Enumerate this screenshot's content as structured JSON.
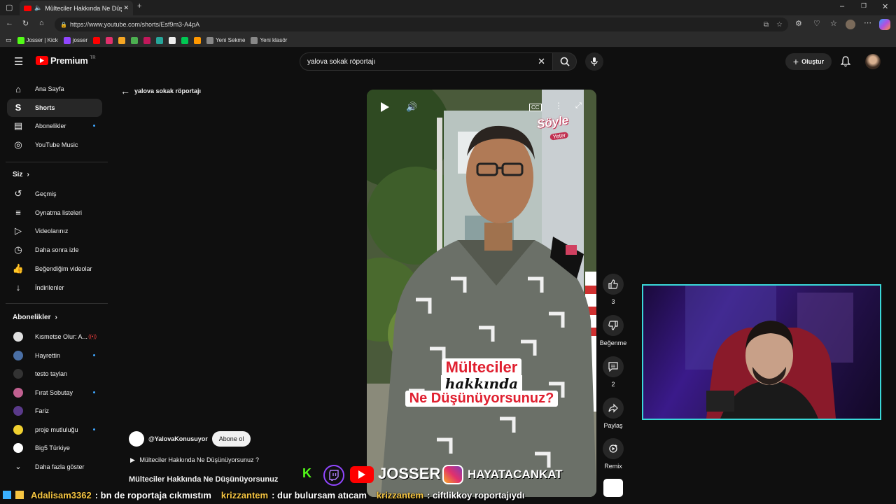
{
  "browser": {
    "tab_title": "Mülteciler Hakkında Ne Düşü",
    "url": "https://www.youtube.com/shorts/Esf9m3-A4pA",
    "bookmarks": [
      {
        "label": "Josser | Kick",
        "color": "#53fc18"
      },
      {
        "label": "josser",
        "color": "#9146ff"
      },
      {
        "label": "",
        "color": "#ff0000"
      },
      {
        "label": "",
        "color": "#e1306c"
      },
      {
        "label": "",
        "color": "#f5a623"
      },
      {
        "label": "",
        "color": "#4caf50"
      },
      {
        "label": "",
        "color": "#c2185b"
      },
      {
        "label": "",
        "color": "#26a69a"
      },
      {
        "label": "",
        "color": "#eeeeee"
      },
      {
        "label": "",
        "color": "#00c853"
      },
      {
        "label": "",
        "color": "#ff9800"
      },
      {
        "label": "Yeni Sekme",
        "color": "#888888"
      },
      {
        "label": "Yeni klasör",
        "color": "#888888"
      }
    ]
  },
  "header": {
    "logo_text": "Premium",
    "logo_region": "TR",
    "search_value": "yalova sokak röportajı",
    "create_label": "Oluştur"
  },
  "sidebar": {
    "main": [
      {
        "label": "Ana Sayfa",
        "icon": "home-icon"
      },
      {
        "label": "Shorts",
        "icon": "shorts-icon"
      },
      {
        "label": "Abonelikler",
        "icon": "subscriptions-icon"
      },
      {
        "label": "YouTube Music",
        "icon": "music-icon"
      }
    ],
    "you_heading": "Siz",
    "you": [
      {
        "label": "Geçmiş",
        "icon": "history-icon"
      },
      {
        "label": "Oynatma listeleri",
        "icon": "playlists-icon"
      },
      {
        "label": "Videolarınız",
        "icon": "your-videos-icon"
      },
      {
        "label": "Daha sonra izle",
        "icon": "watch-later-icon"
      },
      {
        "label": "Beğendiğim videolar",
        "icon": "liked-icon"
      },
      {
        "label": "İndirilenler",
        "icon": "downloads-icon"
      }
    ],
    "subs_heading": "Abonelikler",
    "subs": [
      {
        "label": "Kısmetse Olur: A...",
        "color": "#e0e0e0"
      },
      {
        "label": "Hayrettin",
        "color": "#4a6fa5"
      },
      {
        "label": "testo taylan",
        "color": "#333333"
      },
      {
        "label": "Fırat Sobutay",
        "color": "#c06090"
      },
      {
        "label": "Fariz",
        "color": "#5a3a8a"
      },
      {
        "label": "proje mutluluğu",
        "color": "#f0d030"
      },
      {
        "label": "Big5 Türkiye",
        "color": "#ffffff"
      }
    ],
    "show_more": "Daha fazla göster"
  },
  "main": {
    "back_label": "yalova sokak röportajı",
    "video_caption_line1": "Mülteciler",
    "video_caption_line2": "hakkında",
    "video_caption_line3": "Ne Düşünüyorsunuz?",
    "video_logo_line1": "Söyle",
    "video_logo_line2": "Yeter",
    "channel": "@YalovaKonusuyor",
    "subscribe_label": "Abone ol",
    "description": "Mülteciler Hakkında Ne Düşünüyorsunuz ?",
    "title": "Mülteciler Hakkında Ne Düşünüyorsunuz",
    "likes": "3",
    "dislike_label": "Beğenme",
    "comments": "2",
    "share_label": "Paylaş",
    "remix_label": "Remix"
  },
  "overlay": {
    "josser": "JOSSER",
    "insta": "HAYATACANKAT",
    "chat": [
      {
        "user": "Adalisam3362",
        "msg": ": bn de roportaja cıkmıstım"
      },
      {
        "user": "krizzantem",
        "msg": ": dur bulursam atıcam"
      },
      {
        "user": "krizzantem",
        "msg": ": ciftlikkoy roportajıydı"
      }
    ]
  }
}
